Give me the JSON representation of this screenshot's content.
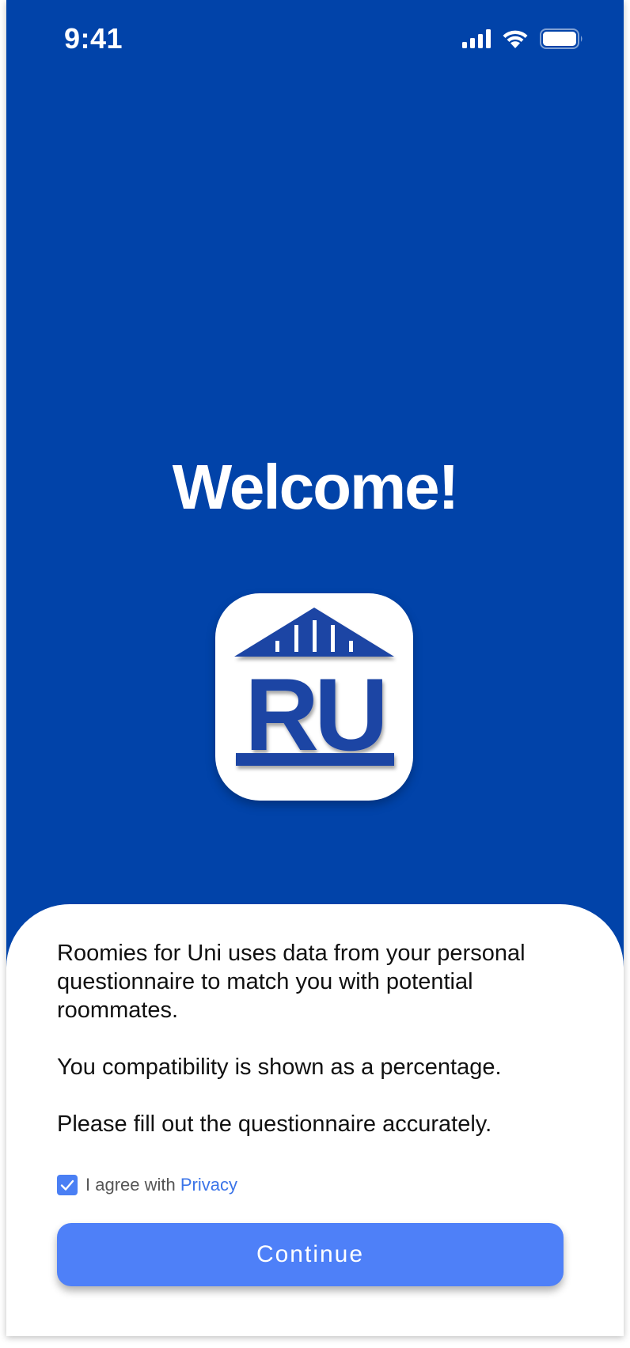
{
  "status_bar": {
    "time": "9:41",
    "icons": [
      "cellular-signal-icon",
      "wifi-icon",
      "battery-icon"
    ]
  },
  "welcome": {
    "title": "Welcome!"
  },
  "logo": {
    "text": "RU",
    "icon": "app-logo-icon",
    "color": "#1f44a4"
  },
  "info": {
    "paragraph1": "Roomies for Uni uses data from your personal questionnaire to match you with potential roommates.",
    "paragraph2": "You compatibility is shown as a percentage.",
    "paragraph3": "Please fill out the questionnaire accurately."
  },
  "agreement": {
    "prefix": "I agree with ",
    "link": "Privacy",
    "checked": true
  },
  "continue_button": {
    "label": "Continue"
  },
  "colors": {
    "background": "#0143a9",
    "accent": "#4e80f8",
    "link": "#3b74e8"
  }
}
